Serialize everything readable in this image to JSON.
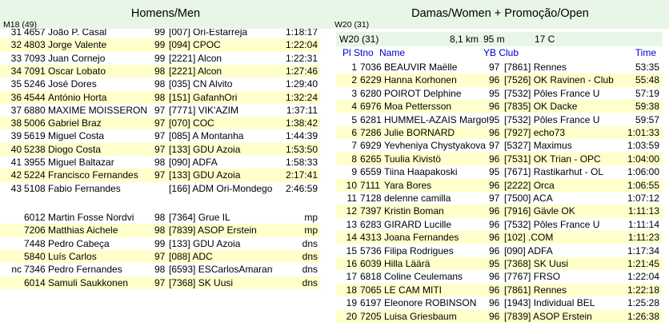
{
  "left": {
    "title": "Homens/Men",
    "class_label": "M18 (49)",
    "results": [
      {
        "rank": "31",
        "stno": "4657",
        "name": "João P. Casal",
        "yb": "99",
        "club": "[007] Ori-Estarreja",
        "time": "1:18:17"
      },
      {
        "rank": "32",
        "stno": "4803",
        "name": "Jorge Valente",
        "yb": "99",
        "club": "[094] CPOC",
        "time": "1:22:04"
      },
      {
        "rank": "33",
        "stno": "7093",
        "name": "Juan Cornejo",
        "yb": "99",
        "club": "[2221] Alcon",
        "time": "1:22:31"
      },
      {
        "rank": "34",
        "stno": "7091",
        "name": "Oscar Lobato",
        "yb": "98",
        "club": "[2221] Alcon",
        "time": "1:27:46"
      },
      {
        "rank": "35",
        "stno": "5246",
        "name": "José Dores",
        "yb": "98",
        "club": "[035] CN Alvito",
        "time": "1:29:40"
      },
      {
        "rank": "36",
        "stno": "4544",
        "name": "António Horta",
        "yb": "98",
        "club": "[151] GafanhOri",
        "time": "1:32:24"
      },
      {
        "rank": "37",
        "stno": "6880",
        "name": "MAXIME MOISSERON",
        "yb": "97",
        "club": "[7771] VIK'AZIM",
        "time": "1:37:11"
      },
      {
        "rank": "38",
        "stno": "5006",
        "name": "Gabriel Braz",
        "yb": "97",
        "club": "[070] COC",
        "time": "1:38:42"
      },
      {
        "rank": "39",
        "stno": "5619",
        "name": "Miguel Costa",
        "yb": "97",
        "club": "[085] A Montanha",
        "time": "1:44:39"
      },
      {
        "rank": "40",
        "stno": "5238",
        "name": "Diogo Costa",
        "yb": "97",
        "club": "[133] GDU Azoia",
        "time": "1:53:50"
      },
      {
        "rank": "41",
        "stno": "3955",
        "name": "Miguel Baltazar",
        "yb": "98",
        "club": "[090] ADFA",
        "time": "1:58:33"
      },
      {
        "rank": "42",
        "stno": "5224",
        "name": "Francisco Fernandes",
        "yb": "97",
        "club": "[133] GDU Azoia",
        "time": "2:17:41"
      },
      {
        "rank": "43",
        "stno": "5108",
        "name": "Fabio Fernandes",
        "yb": "",
        "club": "[166] ADM Ori-Mondego",
        "time": "2:46:59"
      }
    ],
    "others": [
      {
        "rank": "",
        "stno": "6012",
        "name": "Martin Fosse Nordvi",
        "yb": "98",
        "club": "[7364] Grue IL",
        "res": "mp"
      },
      {
        "rank": "",
        "stno": "7206",
        "name": "Matthias Aichele",
        "yb": "98",
        "club": "[7839] ASOP Erstein",
        "res": "mp"
      },
      {
        "rank": "",
        "stno": "7448",
        "name": "Pedro Cabeça",
        "yb": "99",
        "club": "[133] GDU Azoia",
        "res": "dns"
      },
      {
        "rank": "",
        "stno": "5840",
        "name": "Luís Carlos",
        "yb": "97",
        "club": "[088] ADC",
        "res": "dns"
      },
      {
        "rank": "nc",
        "stno": "7346",
        "name": "Pedro Fernandes",
        "yb": "98",
        "club": "[6593] ESCarlosAmarante",
        "res": "dns"
      },
      {
        "rank": "",
        "stno": "6014",
        "name": "Samuli Saukkonen",
        "yb": "97",
        "club": "[7368] SK Uusi",
        "res": "dns"
      }
    ]
  },
  "right": {
    "title": "Damas/Women + Promoção/Open",
    "class_label": "W20 (31)",
    "course": {
      "class": "W20 (31)",
      "distance": "8,1 km",
      "climb": "95 m",
      "controls": "17 C"
    },
    "columns": {
      "pl_stno": "Pl Stno",
      "name": "Name",
      "yb_club": "YB Club",
      "time": "Time"
    },
    "results": [
      {
        "rank": "1",
        "stno": "7036",
        "name": "BEAUVIR Maëlle",
        "yb": "97",
        "club": "[7861] Rennes",
        "time": "53:35"
      },
      {
        "rank": "2",
        "stno": "6229",
        "name": "Hanna Korhonen",
        "yb": "96",
        "club": "[7526] OK Ravinen - Club",
        "time": "55:48"
      },
      {
        "rank": "3",
        "stno": "6280",
        "name": "POIROT Delphine",
        "yb": "95",
        "club": "[7532] Pôles France U",
        "time": "57:19"
      },
      {
        "rank": "4",
        "stno": "6976",
        "name": "Moa Pettersson",
        "yb": "96",
        "club": "[7835] OK Dacke",
        "time": "59:38"
      },
      {
        "rank": "5",
        "stno": "6281",
        "name": "HUMMEL-AZAIS Margot",
        "yb": "95",
        "club": "[7532] Pôles France U",
        "time": "59:57"
      },
      {
        "rank": "6",
        "stno": "7286",
        "name": "Julie BORNARD",
        "yb": "96",
        "club": "[7927] echo73",
        "time": "1:01:33"
      },
      {
        "rank": "7",
        "stno": "6929",
        "name": "Yevheniya Chystyakova",
        "yb": "97",
        "club": "[5327] Maximus",
        "time": "1:03:59"
      },
      {
        "rank": "8",
        "stno": "6265",
        "name": "Tuulia Kivistö",
        "yb": "96",
        "club": "[7531] OK Trian - OPC",
        "time": "1:04:00"
      },
      {
        "rank": "9",
        "stno": "6559",
        "name": "Tiina Haapakoski",
        "yb": "95",
        "club": "[7671] Rastikarhut - OL",
        "time": "1:06:00"
      },
      {
        "rank": "10",
        "stno": "7111",
        "name": "Yara Bores",
        "yb": "96",
        "club": "[2222] Orca",
        "time": "1:06:55"
      },
      {
        "rank": "11",
        "stno": "7128",
        "name": "delenne camilla",
        "yb": "97",
        "club": "[7500] ACA",
        "time": "1:07:12"
      },
      {
        "rank": "12",
        "stno": "7397",
        "name": "Kristin Boman",
        "yb": "96",
        "club": "[7916] Gävle OK",
        "time": "1:11:13"
      },
      {
        "rank": "13",
        "stno": "6283",
        "name": "GIRARD Lucille",
        "yb": "96",
        "club": "[7532] Pôles France U",
        "time": "1:11:14"
      },
      {
        "rank": "14",
        "stno": "4313",
        "name": "Joana Fernandes",
        "yb": "96",
        "club": "[102] .COM",
        "time": "1:11:23"
      },
      {
        "rank": "15",
        "stno": "5736",
        "name": "Filipa Rodrigues",
        "yb": "96",
        "club": "[090] ADFA",
        "time": "1:17:34"
      },
      {
        "rank": "16",
        "stno": "6039",
        "name": "Hilla Läärä",
        "yb": "95",
        "club": "[7368] SK Uusi",
        "time": "1:21:45"
      },
      {
        "rank": "17",
        "stno": "6818",
        "name": "Coline Ceulemans",
        "yb": "96",
        "club": "[7767] FRSO",
        "time": "1:22:04"
      },
      {
        "rank": "18",
        "stno": "7065",
        "name": "LE CAM MITI",
        "yb": "96",
        "club": "[7861] Rennes",
        "time": "1:22:18"
      },
      {
        "rank": "19",
        "stno": "6197",
        "name": "Eleonore ROBINSON",
        "yb": "96",
        "club": "[1943] Individual BEL",
        "time": "1:25:28"
      },
      {
        "rank": "20",
        "stno": "7205",
        "name": "Luisa Griesbaum",
        "yb": "96",
        "club": "[7839] ASOP Erstein",
        "time": "1:26:38"
      }
    ]
  },
  "colors": {
    "header_bg": "#e8f6e8",
    "stripe": "#ffffcc",
    "column_header": "#0000cc"
  }
}
